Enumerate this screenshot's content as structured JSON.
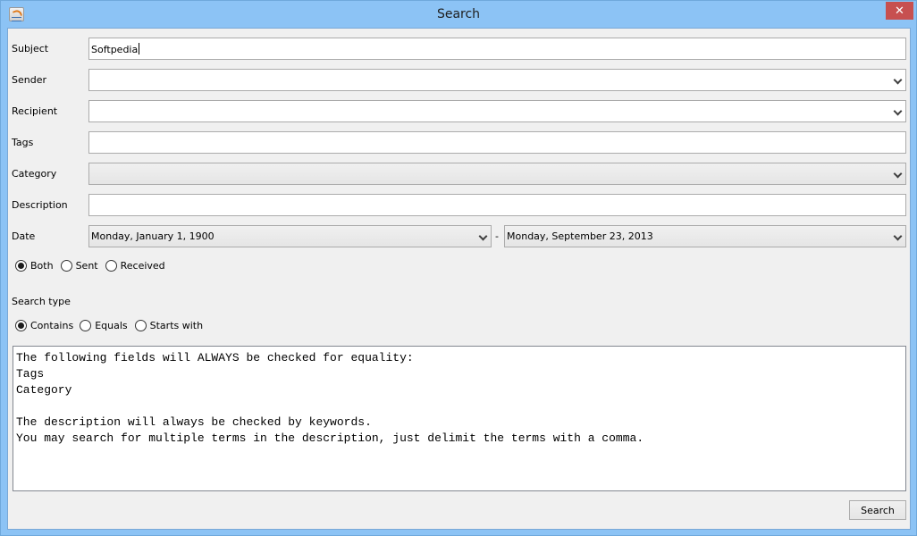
{
  "window": {
    "title": "Search",
    "close_glyph": "✕"
  },
  "form": {
    "subject": {
      "label": "Subject",
      "value": "Softpedia"
    },
    "sender": {
      "label": "Sender",
      "value": ""
    },
    "recipient": {
      "label": "Recipient",
      "value": ""
    },
    "tags": {
      "label": "Tags",
      "value": ""
    },
    "category": {
      "label": "Category",
      "value": ""
    },
    "description": {
      "label": "Description",
      "value": ""
    },
    "date": {
      "label": "Date",
      "from": "Monday, January 1, 1900",
      "separator": "-",
      "to": "Monday, September 23, 2013"
    }
  },
  "direction": {
    "options": [
      {
        "label": "Both",
        "checked": true
      },
      {
        "label": "Sent",
        "checked": false
      },
      {
        "label": "Received",
        "checked": false
      }
    ]
  },
  "search_type": {
    "label": "Search type",
    "options": [
      {
        "label": "Contains",
        "checked": true
      },
      {
        "label": "Equals",
        "checked": false
      },
      {
        "label": "Starts with",
        "checked": false
      }
    ]
  },
  "info_text": "The following fields will ALWAYS be checked for equality:\nTags\nCategory\n\nThe description will always be checked by keywords.\nYou may search for multiple terms in the description, just delimit the terms with a comma.",
  "actions": {
    "search_label": "Search"
  }
}
